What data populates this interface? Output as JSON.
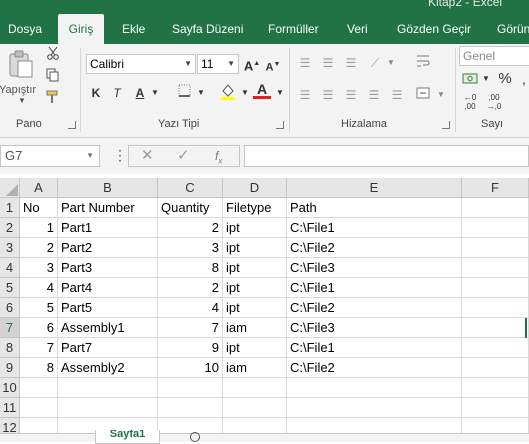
{
  "window": {
    "title": "Kitap2 - Excel"
  },
  "tabs": [
    {
      "label": "Dosya",
      "active": false
    },
    {
      "label": "Giriş",
      "active": true
    },
    {
      "label": "Ekle",
      "active": false
    },
    {
      "label": "Sayfa Düzeni",
      "active": false
    },
    {
      "label": "Formüller",
      "active": false
    },
    {
      "label": "Veri",
      "active": false
    },
    {
      "label": "Gözden Geçir",
      "active": false
    },
    {
      "label": "Görün",
      "active": false
    }
  ],
  "ribbon": {
    "groups": [
      "Pano",
      "Yazı Tipi",
      "Hizalama",
      "Sayı"
    ],
    "paste_label": "Yapıştır",
    "font_name": "Calibri",
    "font_size": "11",
    "number_format": "Genel",
    "icons": [
      "cut-icon",
      "copy-icon",
      "format-painter-icon",
      "bold-icon",
      "italic-icon",
      "underline-icon",
      "border-icon",
      "fill-color-icon",
      "font-color-icon",
      "align-icon",
      "wrap-text-icon",
      "merge-icon",
      "percent-icon"
    ]
  },
  "formula_bar": {
    "name_box": "G7",
    "formula": ""
  },
  "sheet": {
    "columns": [
      "A",
      "B",
      "C",
      "D",
      "E",
      "F"
    ],
    "rows": [
      "1",
      "2",
      "3",
      "4",
      "5",
      "6",
      "7",
      "8",
      "9",
      "10",
      "11",
      "12"
    ],
    "selected_row": "7",
    "cells": [
      [
        "No",
        "Part Number",
        "Quantity",
        "Filetype",
        "Path"
      ],
      [
        "1",
        "Part1",
        "2",
        "ipt",
        "C:\\File1"
      ],
      [
        "2",
        "Part2",
        "3",
        "ipt",
        "C:\\File2"
      ],
      [
        "3",
        "Part3",
        "8",
        "ipt",
        "C:\\File3"
      ],
      [
        "4",
        "Part4",
        "2",
        "ipt",
        "C:\\File1"
      ],
      [
        "5",
        "Part5",
        "4",
        "ipt",
        "C:\\File2"
      ],
      [
        "6",
        "Assembly1",
        "7",
        "iam",
        "C:\\File3"
      ],
      [
        "7",
        "Part7",
        "9",
        "ipt",
        "C:\\File1"
      ],
      [
        "8",
        "Assembly2",
        "10",
        "iam",
        "C:\\File2"
      ]
    ]
  },
  "sheet_tab": {
    "label": "Sayfa1"
  }
}
